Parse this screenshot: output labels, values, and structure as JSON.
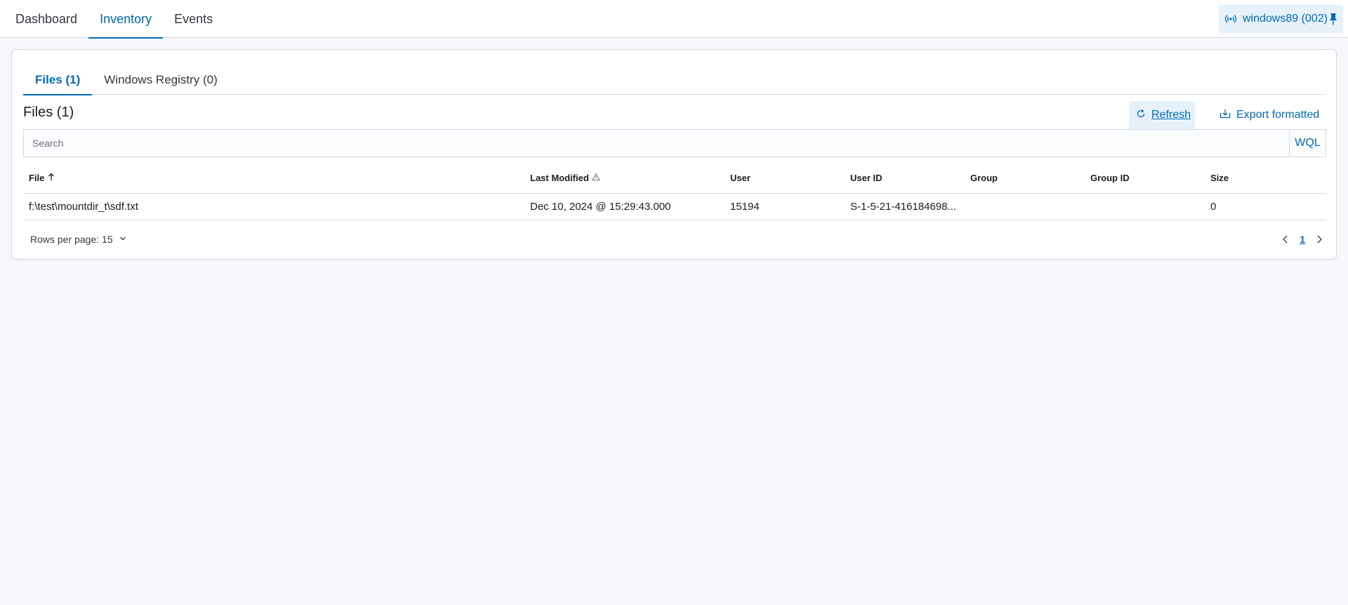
{
  "nav": {
    "tabs": [
      {
        "label": "Dashboard"
      },
      {
        "label": "Inventory"
      },
      {
        "label": "Events"
      }
    ],
    "active": "Inventory"
  },
  "agent": {
    "label": "windows89 (002)",
    "status_icon": "signal-icon",
    "pin_icon": "pin-icon"
  },
  "subtabs": [
    {
      "label": "Files (1)"
    },
    {
      "label": "Windows Registry (0)"
    }
  ],
  "section": {
    "title": "Files (1)"
  },
  "toolbar": {
    "refresh_label": "Refresh",
    "export_label": "Export formatted"
  },
  "search": {
    "placeholder": "Search",
    "value": "",
    "wql_label": "WQL"
  },
  "table": {
    "columns": [
      "File",
      "Last Modified",
      "User",
      "User ID",
      "Group",
      "Group ID",
      "Size"
    ],
    "rows": [
      [
        "f:\\test\\mountdir_t\\sdf.txt",
        "Dec 10, 2024 @ 15:29:43.000",
        "15194",
        "S-1-5-21-416184698...",
        "",
        "",
        "0"
      ]
    ]
  },
  "pagination": {
    "rows_per_page_label": "Rows per page: 15",
    "current_page": "1"
  },
  "colors": {
    "accent": "#006bb8",
    "accent_bg": "#e6f1fa",
    "border": "#d3dae6",
    "page_bg": "#f7f8fc"
  }
}
